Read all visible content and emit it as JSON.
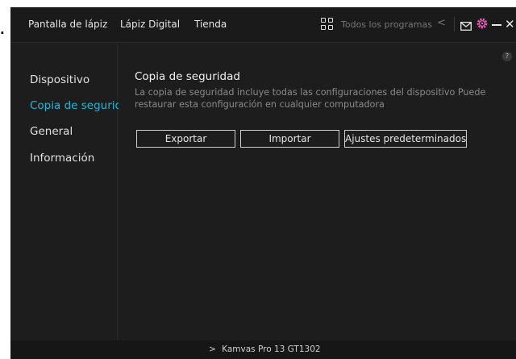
{
  "marker": ".",
  "nav": {
    "tabs": [
      "Pantalla de lápiz",
      "Lápiz Digital",
      "Tienda"
    ],
    "apps_label": "Todos los programas"
  },
  "icons": {
    "apps": "apps-grid-icon",
    "back": "chevron-left-icon",
    "mail": "mail-icon",
    "settings": "gear-icon",
    "minimize": "minimize-icon",
    "close": "close-icon",
    "help": "help-icon",
    "device": "chevron-right-icon"
  },
  "icon_glyphs": {
    "back": "<",
    "close": "✕",
    "help": "?",
    "device_arrow": ">"
  },
  "colors": {
    "accent": "#24b5d6",
    "settings_icon": "#e85db8",
    "background": "#1d1d1d"
  },
  "sidebar": {
    "items": [
      {
        "label": "Dispositivo",
        "active": false
      },
      {
        "label": "Copia de segurid...",
        "active": true
      },
      {
        "label": "General",
        "active": false
      },
      {
        "label": "Información",
        "active": false
      }
    ]
  },
  "main": {
    "title": "Copia de seguridad",
    "description": "La copia de seguridad incluye todas las configuraciones del dispositivo Puede restaurar esta configuración en cualquier computadora",
    "buttons": {
      "export": "Exportar",
      "import": "Importar",
      "defaults": "Ajustes predeterminados"
    }
  },
  "statusbar": {
    "device": "Kamvas Pro 13 GT1302"
  }
}
